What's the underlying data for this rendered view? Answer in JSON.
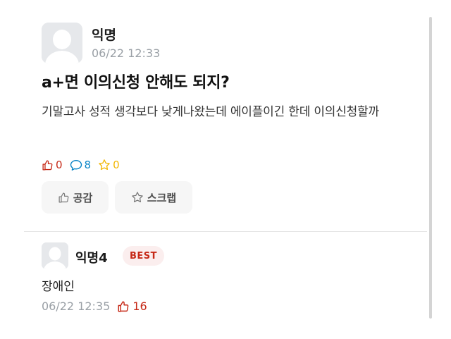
{
  "post": {
    "author": "익명",
    "time": "06/22 12:33",
    "title": "a+면 이의신청 안해도 되지?",
    "body": "기말고사 성적 생각보다 낮게나왔는데 에이플이긴 한데 이의신청할까",
    "stats": {
      "likes": "0",
      "comments": "8",
      "scraps": "0"
    },
    "buttons": {
      "like_label": "공감",
      "scrap_label": "스크랩"
    }
  },
  "comment": {
    "author": "익명4",
    "badge": "BEST",
    "text": "장애인",
    "time": "06/22 12:35",
    "likes": "16"
  },
  "colors": {
    "like": "#c62917",
    "comment": "#0a85c7",
    "scrap": "#f2b705",
    "button_bg": "#f6f6f6",
    "badge_bg": "#fbeeee"
  },
  "icons": [
    "avatar-icon",
    "thumb-up-icon",
    "comment-bubble-icon",
    "star-icon"
  ]
}
